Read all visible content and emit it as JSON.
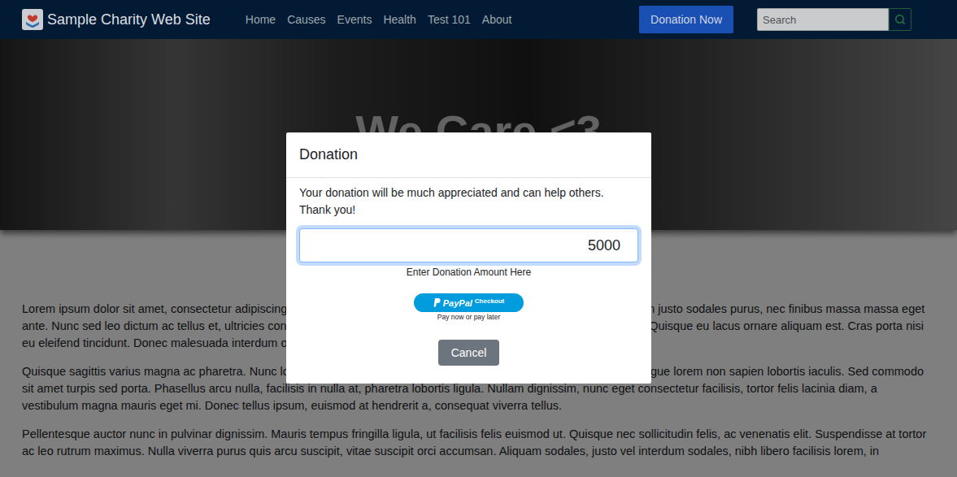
{
  "navbar": {
    "title": "Sample Charity Web Site",
    "links": [
      "Home",
      "Causes",
      "Events",
      "Health",
      "Test 101",
      "About"
    ],
    "donate_button": "Donation Now",
    "search": {
      "placeholder": "Search"
    }
  },
  "hero": {
    "title": "We Care <3"
  },
  "paragraphs": [
    "Lorem ipsum dolor sit amet, consectetur adipiscing elit. Vivamus vel lorem euismod, nulla sit amet rhoncus iaculis, sapien justo sodales purus, nec finibus massa massa eget ante. Nunc sed leo dictum ac tellus et, ultricies condimentum est. Maecenas rutrum erat tincidunt dui rutrum fermentum. Quisque eu lacus ornare aliquam est. Cras porta nisi eu eleifend tincidunt. Donec malesuada interdum orci sit amet semper. Nam lorem vel in lacus.",
    "Quisque sagittis varius magna ac pharetra. Nunc lobortis sapien nisl, ac fringilla enim pellentesque vitae. Vestibulum congue lorem non sapien lobortis iaculis. Sed commodo sit amet turpis sed porta. Phasellus arcu nulla, facilisis in nulla at, pharetra lobortis ligula. Nullam dignissim, nunc eget consectetur facilisis, tortor felis lacinia diam, a vestibulum magna mauris eget mi. Donec tellus ipsum, euismod at hendrerit a, consequat viverra tellus.",
    "Pellentesque auctor nunc in pulvinar dignissim. Mauris tempus fringilla ligula, ut facilisis felis euismod ut. Quisque nec sollicitudin felis, ac venenatis elit. Suspendisse at tortor ac leo rutrum maximus. Nulla viverra purus quis arcu suscipit, vitae suscipit orci accumsan. Aliquam sodales, justo vel interdum sodales, nibh libero facilisis lorem, in"
  ],
  "modal": {
    "title": "Donation",
    "message": "Your donation will be much appreciated and can help others. Thank you!",
    "amount": "5000",
    "amount_hint": "Enter Donation Amount Here",
    "paypal": {
      "brand": "PayPal",
      "label": "Checkout",
      "tagline": "Pay now or pay later"
    },
    "cancel": "Cancel"
  }
}
